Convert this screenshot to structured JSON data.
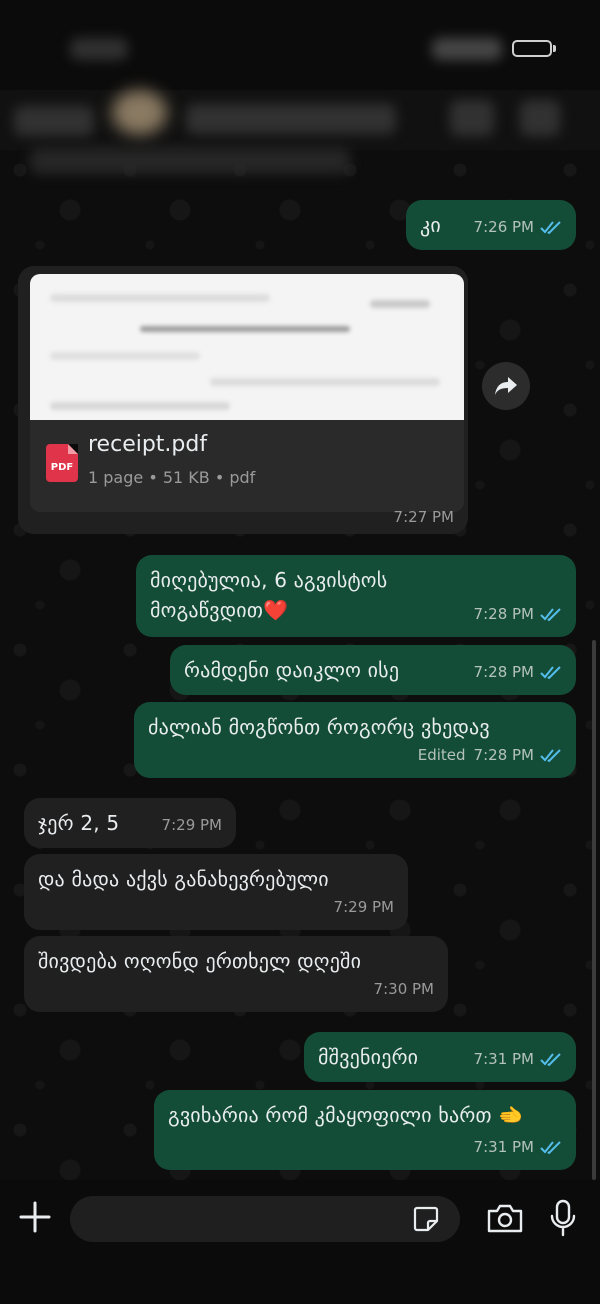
{
  "messages": [
    {
      "text": "კი",
      "time": "7:26 PM"
    },
    {
      "text": "მიღებულია, 6 აგვისტოს მოგაწვდით❤️",
      "time": "7:28 PM"
    },
    {
      "text": "რამდენი დაიკლო ისე",
      "time": "7:28 PM"
    },
    {
      "text": "ძალიან მოგწონთ როგორც ვხედავ",
      "time": "7:28 PM",
      "edited": "Edited"
    },
    {
      "text": "ჯერ 2, 5",
      "time": "7:29 PM"
    },
    {
      "text": "და მადა აქვს განახევრებული",
      "time": "7:29 PM"
    },
    {
      "text": "შივდება ოღონდ ერთხელ დღეში",
      "time": "7:30 PM"
    },
    {
      "text": "მშვენიერი",
      "time": "7:31 PM"
    },
    {
      "text": "გვიხარია რომ კმაყოფილი ხართ 🫲",
      "time": "7:31 PM"
    }
  ],
  "document": {
    "icon_label": "PDF",
    "file_name": "receipt.pdf",
    "details": "1 page • 51 KB • pdf",
    "time": "7:27 PM"
  },
  "composer": {
    "placeholder": ""
  },
  "colors": {
    "outgoing": "#144d37",
    "incoming": "#202020",
    "read_ticks": "#53bdeb"
  }
}
